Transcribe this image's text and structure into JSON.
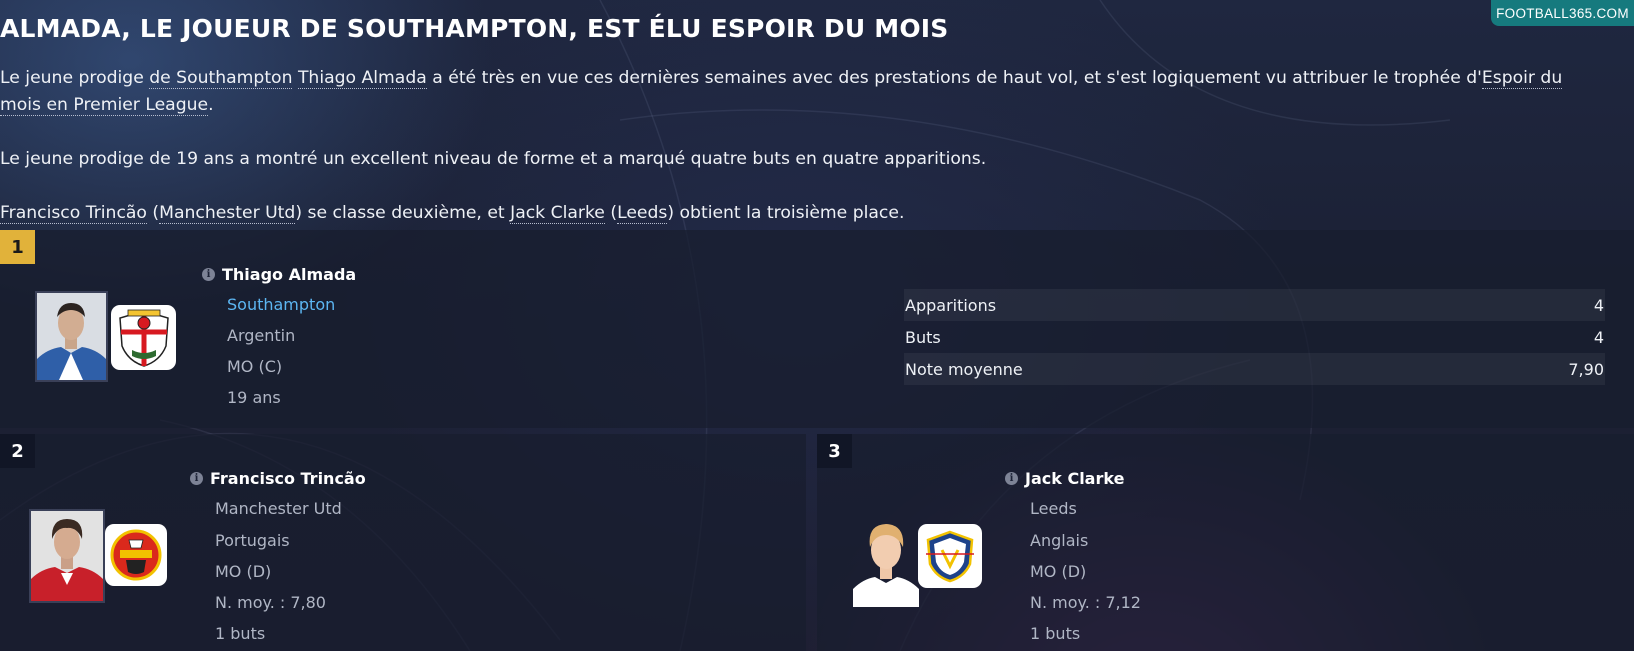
{
  "watermark": "FOOTBALL365.COM",
  "headline": "ALMADA, LE JOUEUR DE SOUTHAMPTON, EST ÉLU ESPOIR DU MOIS",
  "paragraphs": {
    "p1": {
      "t1": "Le jeune prodige ",
      "club_link": "de Southampton",
      "t2": " ",
      "player_link": "Thiago Almada",
      "t3": " a été très en vue ces dernières semaines avec des prestations de haut vol, et s'est logiquement vu attribuer le trophée d'",
      "award_link": "Espoir du mois en Premier League",
      "t4": "."
    },
    "p2": "Le jeune prodige de 19 ans a montré un excellent niveau de forme et a marqué quatre buts en quatre apparitions.",
    "p3": {
      "player2_link": "Francisco Trincão",
      "t1": " (",
      "club2_link": "Manchester Utd",
      "t2": ") se classe deuxième, et ",
      "player3_link": "Jack Clarke",
      "t3": " (",
      "club3_link": "Leeds",
      "t4": ") obtient la troisième place."
    }
  },
  "winner": {
    "rank": "1",
    "name": "Thiago Almada",
    "club": "Southampton",
    "nationality": "Argentin",
    "position": "MO (C)",
    "age": "19 ans",
    "stats": [
      {
        "label": "Apparitions",
        "value": "4"
      },
      {
        "label": "Buts",
        "value": "4"
      },
      {
        "label": "Note moyenne",
        "value": "7,90"
      }
    ]
  },
  "second": {
    "rank": "2",
    "name": "Francisco Trincão",
    "club": "Manchester Utd",
    "nationality": "Portugais",
    "position": "MO (D)",
    "rating": "N. moy. : 7,80",
    "goals": "1 buts"
  },
  "third": {
    "rank": "3",
    "name": "Jack Clarke",
    "club": "Leeds",
    "nationality": "Anglais",
    "position": "MO (D)",
    "rating": "N. moy. : 7,12",
    "goals": "1 buts"
  },
  "icons": {
    "info": "info-icon",
    "southampton": "southampton-crest-icon",
    "manutd": "manchester-united-crest-icon",
    "leeds": "leeds-crest-icon"
  },
  "colors": {
    "gold_rank": "#e1b23a",
    "link_blue": "#5cb6f2",
    "watermark_teal": "#167a7e"
  }
}
